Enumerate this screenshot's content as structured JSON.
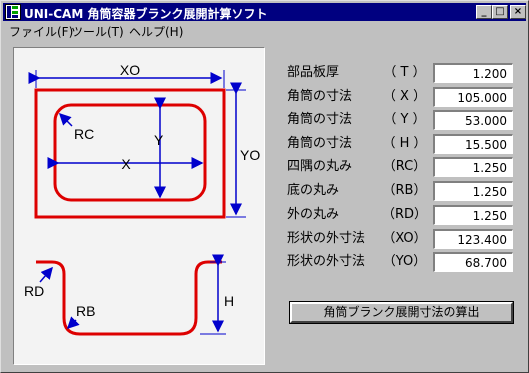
{
  "window": {
    "title": "UNI-CAM 角筒容器ブランク展開計算ソフト",
    "icon_name": "unicam-app-icon",
    "buttons": {
      "minimize": "_",
      "maximize": "□",
      "close": "×"
    }
  },
  "menu": {
    "items": [
      "ファイル(F)",
      "ツール(T)",
      "ヘルプ(H)"
    ]
  },
  "diagram": {
    "labels": {
      "xo": "XO",
      "yo": "YO",
      "rc": "RC",
      "x": "X",
      "y": "Y",
      "rd": "RD",
      "rb": "RB",
      "h": "H"
    },
    "colors": {
      "shape": "#dd0000",
      "dimension": "#0000cc"
    }
  },
  "params": [
    {
      "label": "部品板厚",
      "symbol": "（ T ）",
      "value": "1.200"
    },
    {
      "label": "角筒の寸法",
      "symbol": "（ X ）",
      "value": "105.000"
    },
    {
      "label": "角筒の寸法",
      "symbol": "（ Y ）",
      "value": "53.000"
    },
    {
      "label": "角筒の寸法",
      "symbol": "（ H ）",
      "value": "15.500"
    },
    {
      "label": "四隅の丸み",
      "symbol": "（RC）",
      "value": "1.250"
    },
    {
      "label": "底の丸み",
      "symbol": "（RB）",
      "value": "1.250"
    },
    {
      "label": "外の丸み",
      "symbol": "（RD）",
      "value": "1.250"
    },
    {
      "label": "形状の外寸法",
      "symbol": "（XO）",
      "value": "123.400"
    },
    {
      "label": "形状の外寸法",
      "symbol": "（YO）",
      "value": "68.700"
    }
  ],
  "calc_button": {
    "label": "角筒ブランク展開寸法の算出"
  }
}
